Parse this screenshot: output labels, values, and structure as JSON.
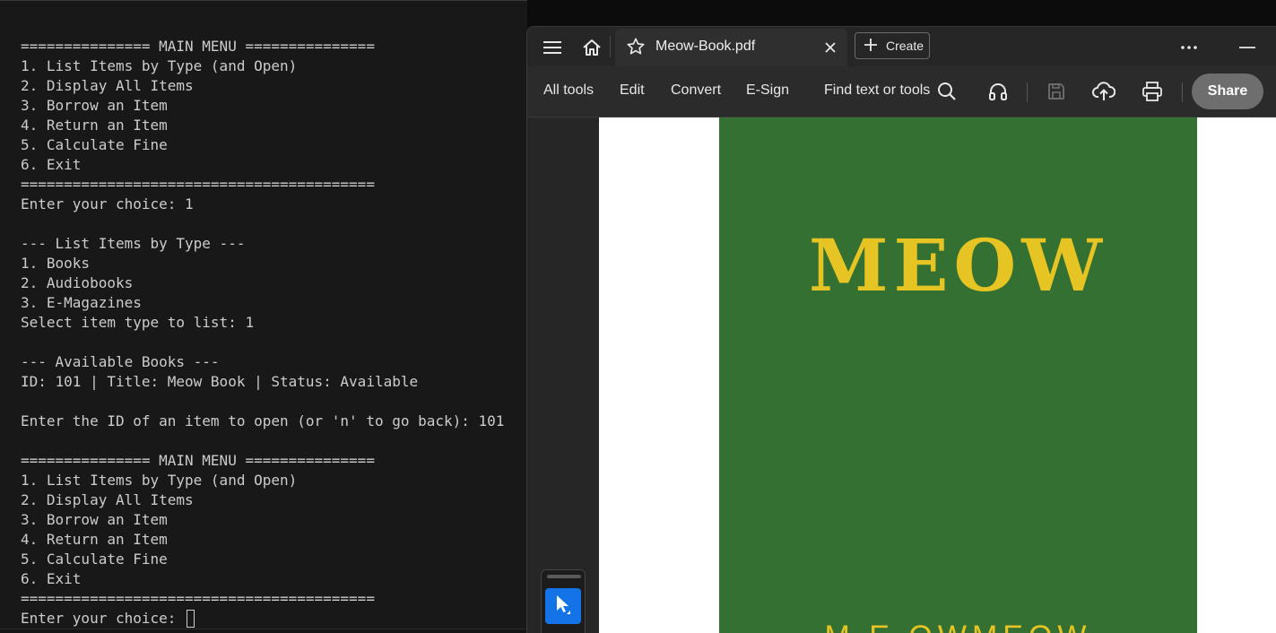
{
  "terminal": {
    "lines": [
      "=============== MAIN MENU ===============",
      "1. List Items by Type (and Open)",
      "2. Display All Items",
      "3. Borrow an Item",
      "4. Return an Item",
      "5. Calculate Fine",
      "6. Exit",
      "=========================================",
      "Enter your choice: 1",
      "",
      "--- List Items by Type ---",
      "1. Books",
      "2. Audiobooks",
      "3. E-Magazines",
      "Select item type to list: 1",
      "",
      "--- Available Books ---",
      "ID: 101 | Title: Meow Book | Status: Available",
      "",
      "Enter the ID of an item to open (or 'n' to go back): 101",
      "",
      "=============== MAIN MENU ===============",
      "1. List Items by Type (and Open)",
      "2. Display All Items",
      "3. Borrow an Item",
      "4. Return an Item",
      "5. Calculate Fine",
      "6. Exit",
      "========================================="
    ],
    "prompt": "Enter your choice: "
  },
  "viewer": {
    "tab_title": "Meow-Book.pdf",
    "create_label": "Create",
    "toolbar": {
      "all_tools": "All tools",
      "edit": "Edit",
      "convert": "Convert",
      "esign": "E-Sign",
      "find": "Find text or tools",
      "share": "Share"
    },
    "icons": [
      "menu-icon",
      "home-icon",
      "star-icon",
      "close-icon",
      "plus-icon",
      "more-icon",
      "minimize-icon",
      "search-icon",
      "headphones-icon",
      "save-icon",
      "cloud-upload-icon",
      "print-icon",
      "cursor-icon"
    ],
    "document": {
      "cover_title": "MEOW",
      "cover_author_partial": "M E OWMEOW",
      "cover_color": "#357033",
      "title_color": "#e6c423"
    }
  },
  "colors": {
    "terminal_bg": "#181818",
    "terminal_text": "#cccccc",
    "accent_blue": "#1473e6"
  }
}
